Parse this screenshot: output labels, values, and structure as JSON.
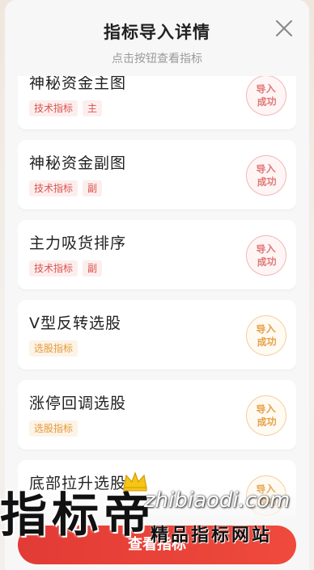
{
  "dialog": {
    "title": "指标导入详情",
    "subtitle": "点击按钮查看指标"
  },
  "indicators": [
    {
      "name": "神秘资金主图",
      "tags": [
        "技术指标",
        "主"
      ],
      "tag_color": "red",
      "status": "导入成功"
    },
    {
      "name": "神秘资金副图",
      "tags": [
        "技术指标",
        "副"
      ],
      "tag_color": "red",
      "status": "导入成功"
    },
    {
      "name": "主力吸货排序",
      "tags": [
        "技术指标",
        "副"
      ],
      "tag_color": "red",
      "status": "导入成功"
    },
    {
      "name": "V型反转选股",
      "tags": [
        "选股指标"
      ],
      "tag_color": "orange",
      "status": "导入成功"
    },
    {
      "name": "涨停回调选股",
      "tags": [
        "选股指标"
      ],
      "tag_color": "orange",
      "status": "导入成功"
    },
    {
      "name": "底部拉升选股",
      "tags": [],
      "tag_color": "orange",
      "status": "导入成功"
    }
  ],
  "bottom_button": {
    "label": "查看指标"
  },
  "watermark": {
    "brand": "指标帝",
    "domain": "zhibiaodi.com",
    "slogan": "精品指标网站"
  },
  "colors": {
    "primary": "#e23b36",
    "tag_red_text": "#d9534f",
    "tag_orange_text": "#e39a3a"
  },
  "icons": {
    "close": "close-icon",
    "crown": "crown-icon"
  }
}
